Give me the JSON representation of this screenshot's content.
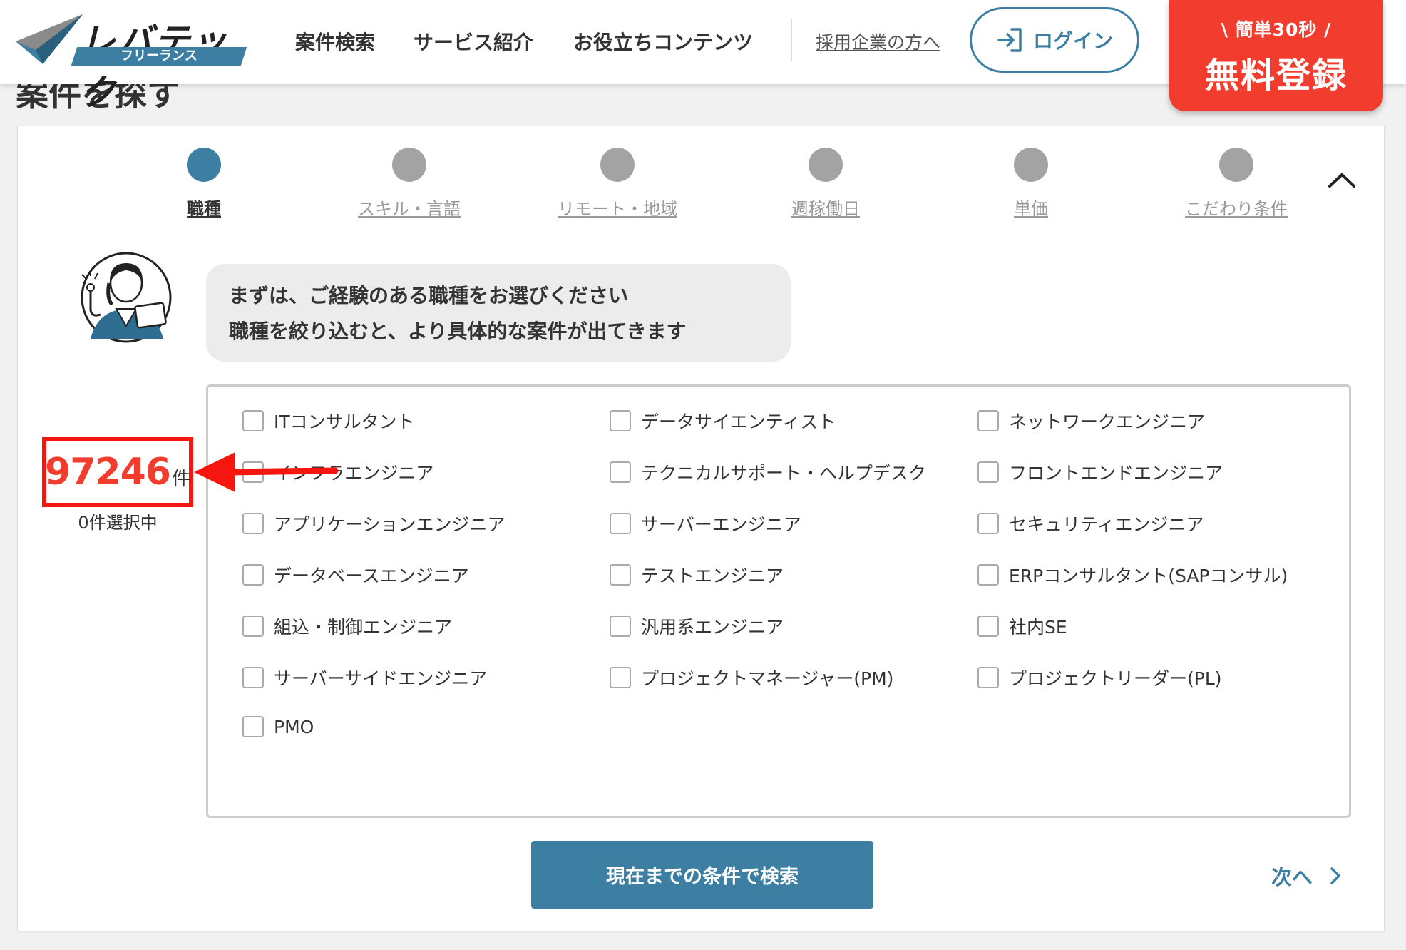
{
  "header": {
    "logo_text": "レバテック",
    "logo_sub": "フリーランス",
    "nav": [
      "案件検索",
      "サービス紹介",
      "お役立ちコンテンツ"
    ],
    "corporate_link": "採用企業の方へ",
    "login_label": "ログイン",
    "register_small": "\\  簡単30秒  /",
    "register_big": "無料登録",
    "accent_color": "#3d7fa3",
    "register_color": "#f23d2e"
  },
  "page_title": "案件を探す",
  "steps": [
    {
      "label": "職種",
      "active": true
    },
    {
      "label": "スキル・言語",
      "active": false
    },
    {
      "label": "リモート・地域",
      "active": false
    },
    {
      "label": "週稼働日",
      "active": false
    },
    {
      "label": "単価",
      "active": false
    },
    {
      "label": "こだわり条件",
      "active": false
    }
  ],
  "message": {
    "line1": "まずは、ご経験のある職種をお選びください",
    "line2": "職種を絞り込むと、より具体的な案件が出てきます"
  },
  "result": {
    "count": "97246",
    "unit": "件",
    "selected": "0件選択中"
  },
  "job_types": [
    [
      "ITコンサルタント",
      "データサイエンティスト",
      "ネットワークエンジニア"
    ],
    [
      "インフラエンジニア",
      "テクニカルサポート・ヘルプデスク",
      "フロントエンドエンジニア"
    ],
    [
      "アプリケーションエンジニア",
      "サーバーエンジニア",
      "セキュリティエンジニア"
    ],
    [
      "データベースエンジニア",
      "テストエンジニア",
      "ERPコンサルタント(SAPコンサル)"
    ],
    [
      "組込・制御エンジニア",
      "汎用系エンジニア",
      "社内SE"
    ],
    [
      "サーバーサイドエンジニア",
      "プロジェクトマネージャー(PM)",
      "プロジェクトリーダー(PL)"
    ],
    [
      "PMO"
    ]
  ],
  "actions": {
    "search_label": "現在までの条件で検索",
    "next_label": "次へ"
  }
}
